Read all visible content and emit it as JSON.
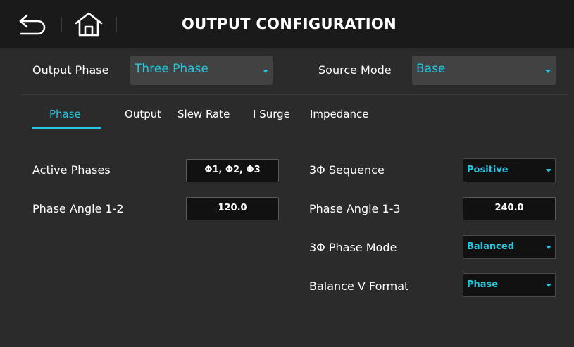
{
  "header": {
    "title": "OUTPUT CONFIGURATION",
    "back_icon": "back-arrow-icon",
    "home_icon": "home-icon"
  },
  "top": {
    "output_phase_label": "Output Phase",
    "output_phase_value": "Three Phase",
    "source_mode_label": "Source Mode",
    "source_mode_value": "Base"
  },
  "tabs": [
    {
      "label": "Phase",
      "active": true
    },
    {
      "label": "Output",
      "active": false
    },
    {
      "label": "Slew Rate",
      "active": false
    },
    {
      "label": "I Surge",
      "active": false
    },
    {
      "label": "Impedance",
      "active": false
    }
  ],
  "fields": {
    "active_phases_label": "Active Phases",
    "active_phases_value": "Φ1, Φ2, Φ3",
    "phase_angle_12_label": "Phase Angle 1-2",
    "phase_angle_12_value": "120.0",
    "sequence_label": "3Φ Sequence",
    "sequence_value": "Positive",
    "phase_angle_13_label": "Phase Angle 1-3",
    "phase_angle_13_value": "240.0",
    "phase_mode_label": "3Φ Phase Mode",
    "phase_mode_value": "Balanced",
    "balance_format_label": "Balance V Format",
    "balance_format_value": "Phase"
  },
  "colors": {
    "accent": "#27c4dd",
    "background": "#2b2b2b",
    "header": "#1a1a1a",
    "field_bg": "#111111"
  }
}
